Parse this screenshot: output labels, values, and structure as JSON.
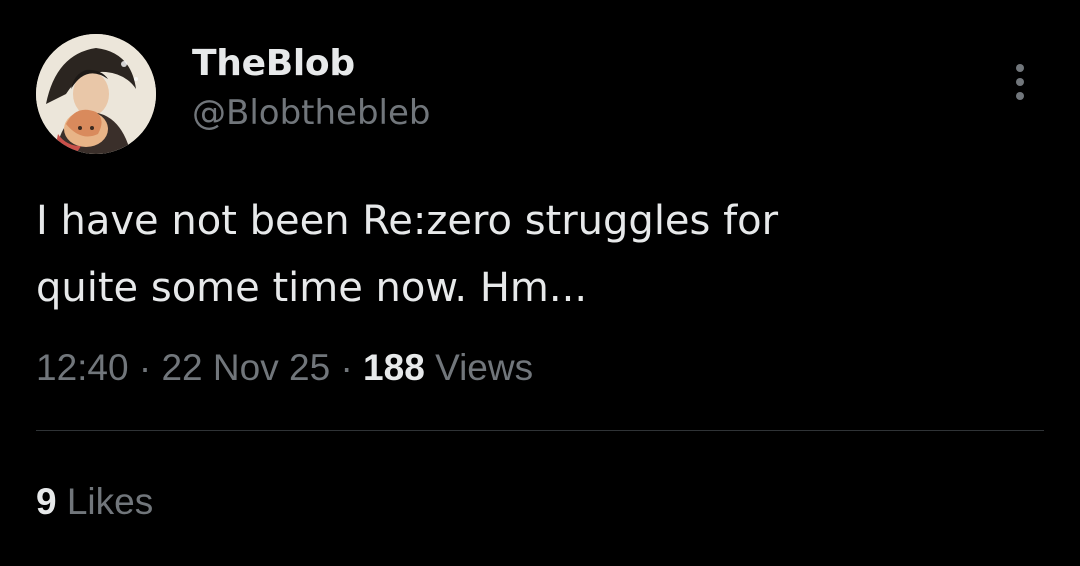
{
  "author": {
    "display_name": "TheBlob",
    "handle": "@Blobthebleb",
    "avatar_icon": "anime-avatar"
  },
  "tweet": {
    "text": "I have not been Re:zero struggles for\nquite some time now. Hm...",
    "time": "12:40",
    "separator": "·",
    "date": "22 Nov 25",
    "views_count": "188",
    "views_label": "Views",
    "likes_count": "9",
    "likes_label": "Likes"
  },
  "actions": {
    "more_icon": "more-vertical-icon"
  },
  "colors": {
    "background": "#000000",
    "primary_text": "#e7e9ea",
    "secondary_text": "#71767b",
    "divider": "#2f3336"
  }
}
